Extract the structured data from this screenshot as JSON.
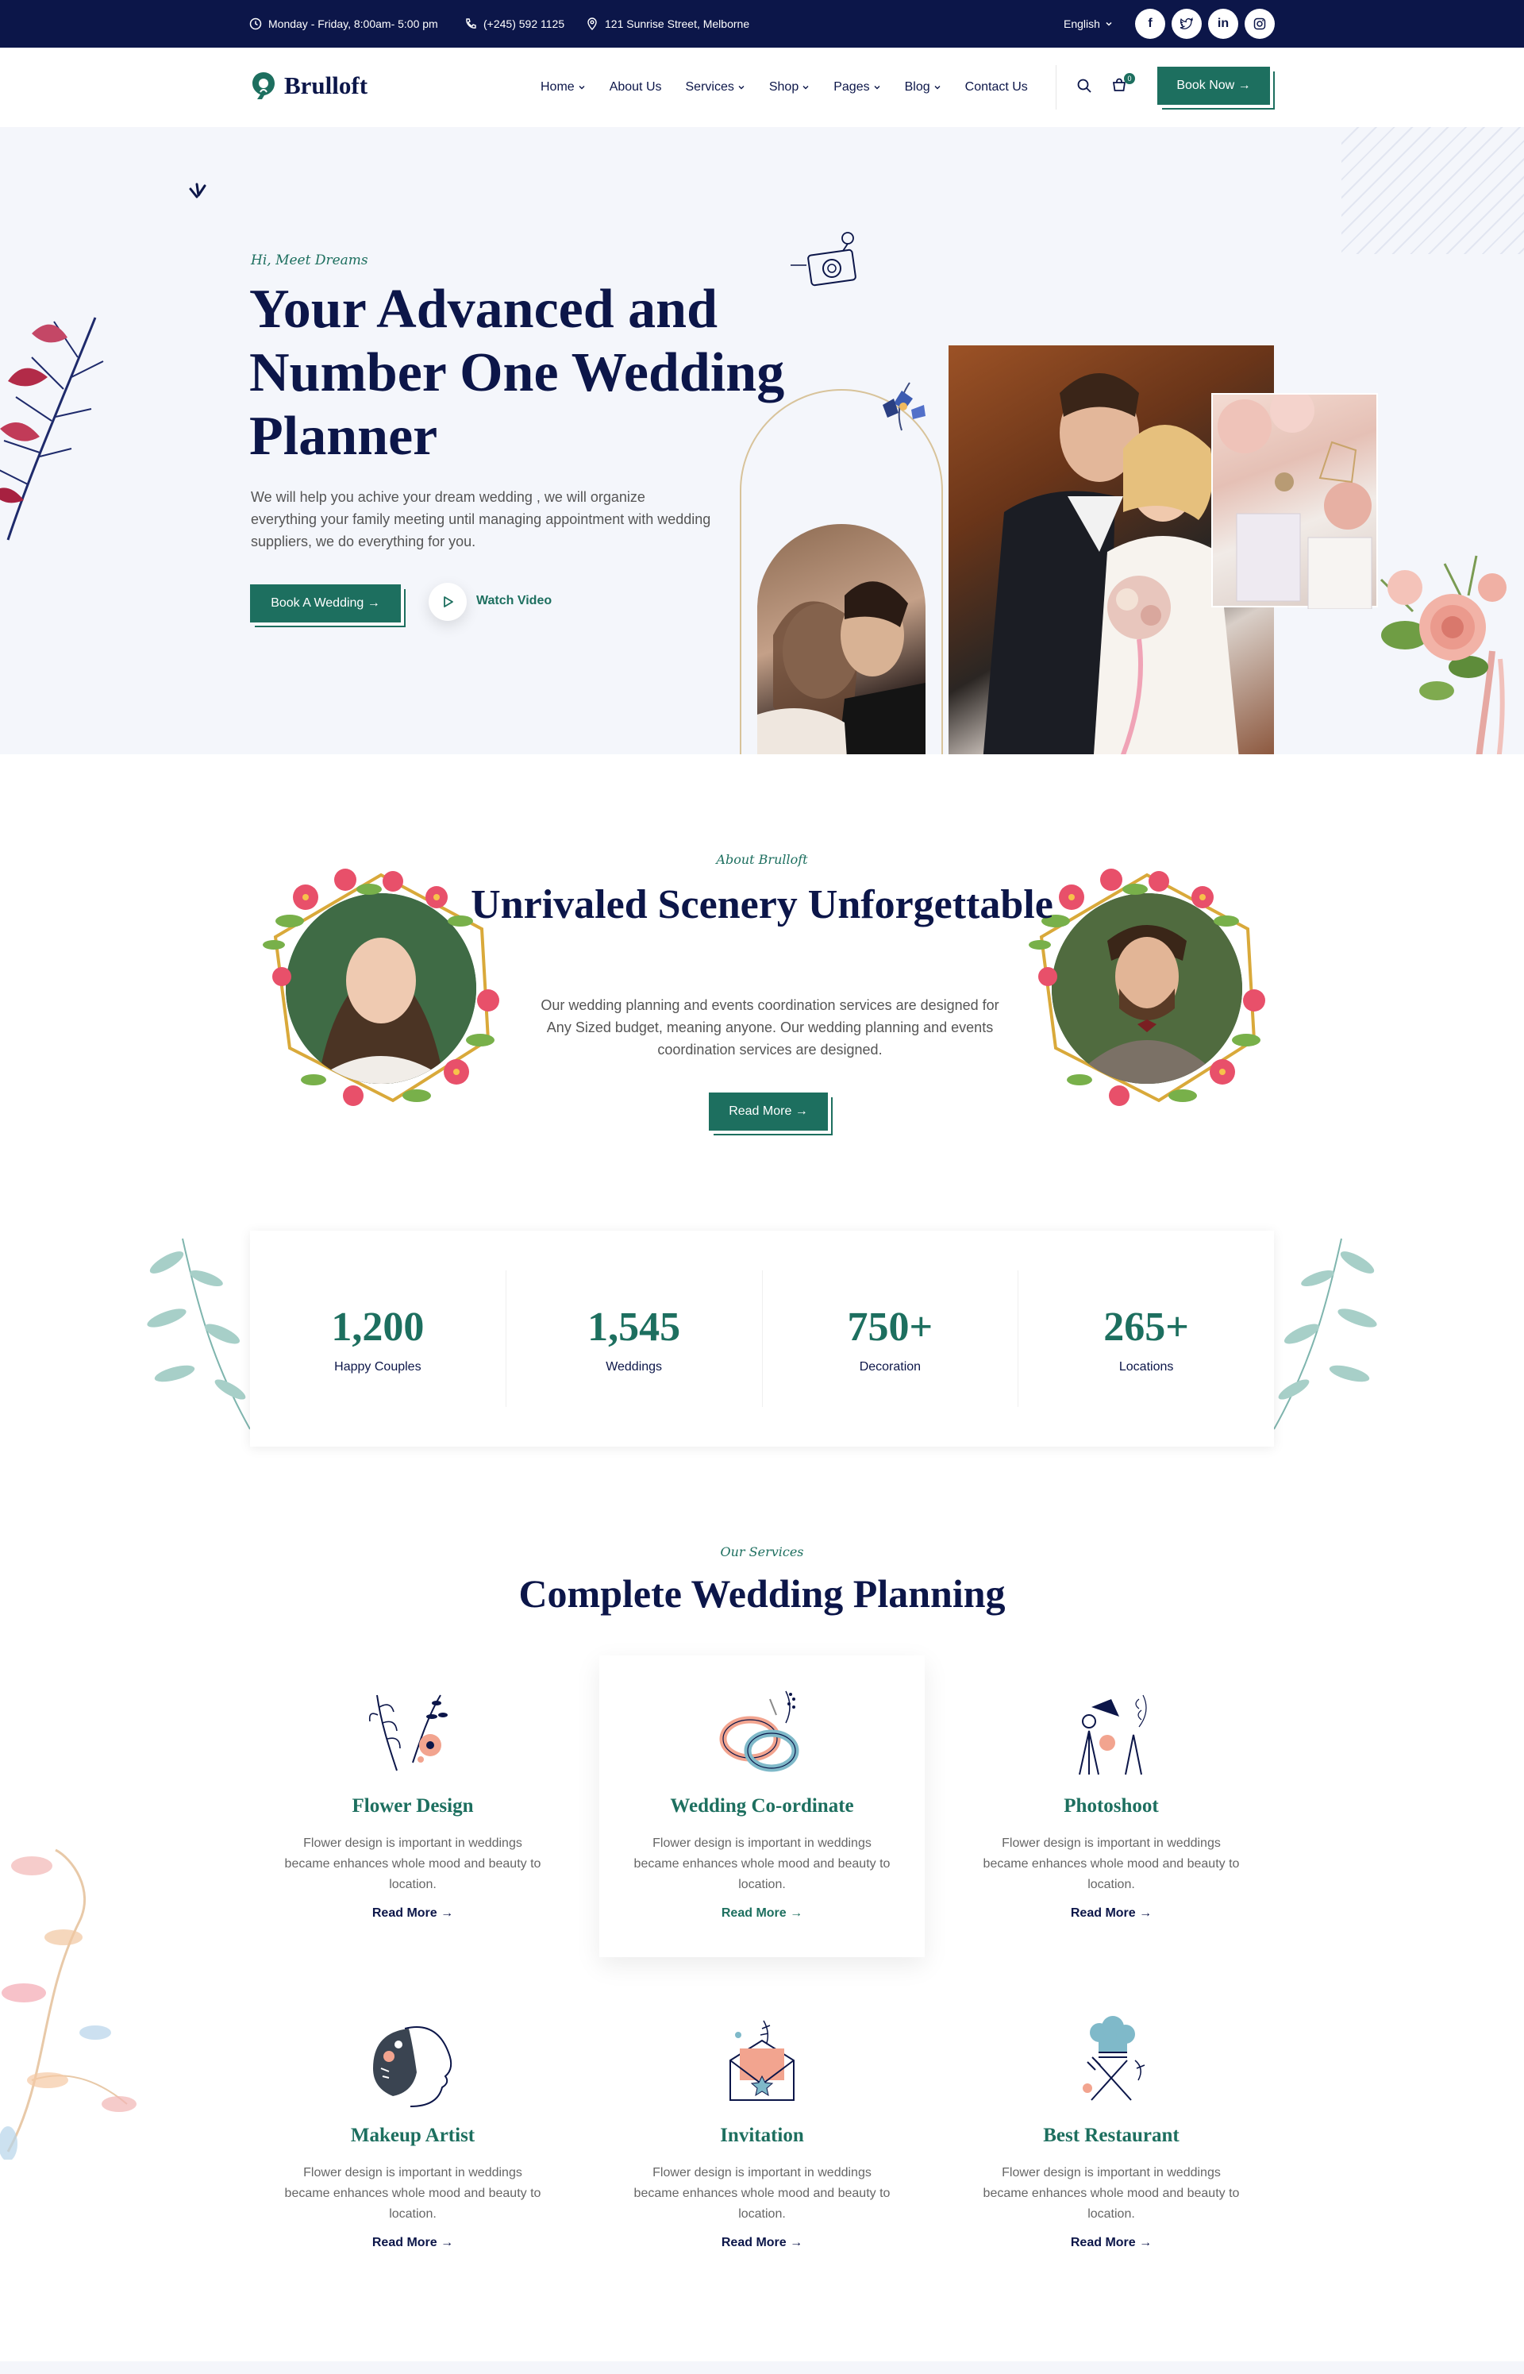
{
  "topbar": {
    "hours": "Monday - Friday, 8:00am- 5:00 pm",
    "phone": "(+245) 592 1125",
    "address": "121 Sunrise Street, Melborne",
    "language": "English"
  },
  "header": {
    "logo": "Brulloft",
    "nav": [
      "Home",
      "About Us",
      "Services",
      "Shop",
      "Pages",
      "Blog",
      "Contact Us"
    ],
    "cart_count": "0",
    "cta": "Book Now →"
  },
  "hero": {
    "subtitle": "Hi, Meet Dreams",
    "title": "Your Advanced and Number One Wedding Planner",
    "description": "We will help you achive your dream wedding , we will organize everything your family meeting until managing appointment with wedding suppliers, we do everything for you.",
    "primary_button": "Book A Wedding →",
    "video_label": "Watch Video"
  },
  "about": {
    "subtitle": "About Brulloft",
    "title": "Unrivaled Scenery Unforgettable",
    "description": "Our wedding planning and events coordination services are designed for Any Sized budget, meaning anyone. Our wedding planning and events coordination services are designed.",
    "button": "Read More →"
  },
  "counters": [
    {
      "value": "1,200",
      "label": "Happy Couples"
    },
    {
      "value": "1,545",
      "label": "Weddings"
    },
    {
      "value": "750+",
      "label": "Decoration"
    },
    {
      "value": "265+",
      "label": "Locations"
    }
  ],
  "services": {
    "subtitle": "Our Services",
    "title": "Complete Wedding Planning",
    "items": [
      {
        "name": "Flower Design",
        "desc": "Flower design is important in weddings became enhances whole mood and beauty to location.",
        "link": "Read More →",
        "icon": "flower-icon"
      },
      {
        "name": "Wedding Co-ordinate",
        "desc": "Flower design is important in weddings became enhances whole mood and beauty to location.",
        "link": "Read More →",
        "icon": "rings-icon"
      },
      {
        "name": "Photoshoot",
        "desc": "Flower design is important in weddings became enhances whole mood and beauty to location.",
        "link": "Read More →",
        "icon": "camera-lights-icon"
      },
      {
        "name": "Makeup Artist",
        "desc": "Flower design is important in weddings became enhances whole mood and beauty to location.",
        "link": "Read More →",
        "icon": "makeup-icon"
      },
      {
        "name": "Invitation",
        "desc": "Flower design is important in weddings became enhances whole mood and beauty to location.",
        "link": "Read More →",
        "icon": "envelope-icon"
      },
      {
        "name": "Best Restaurant",
        "desc": "Flower design is important in weddings became enhances whole mood and beauty to location.",
        "link": "Read More →",
        "icon": "chef-icon"
      }
    ]
  },
  "colors": {
    "navy": "#0c1649",
    "green": "#1d6f5f",
    "hero_bg": "#f4f6fb"
  }
}
